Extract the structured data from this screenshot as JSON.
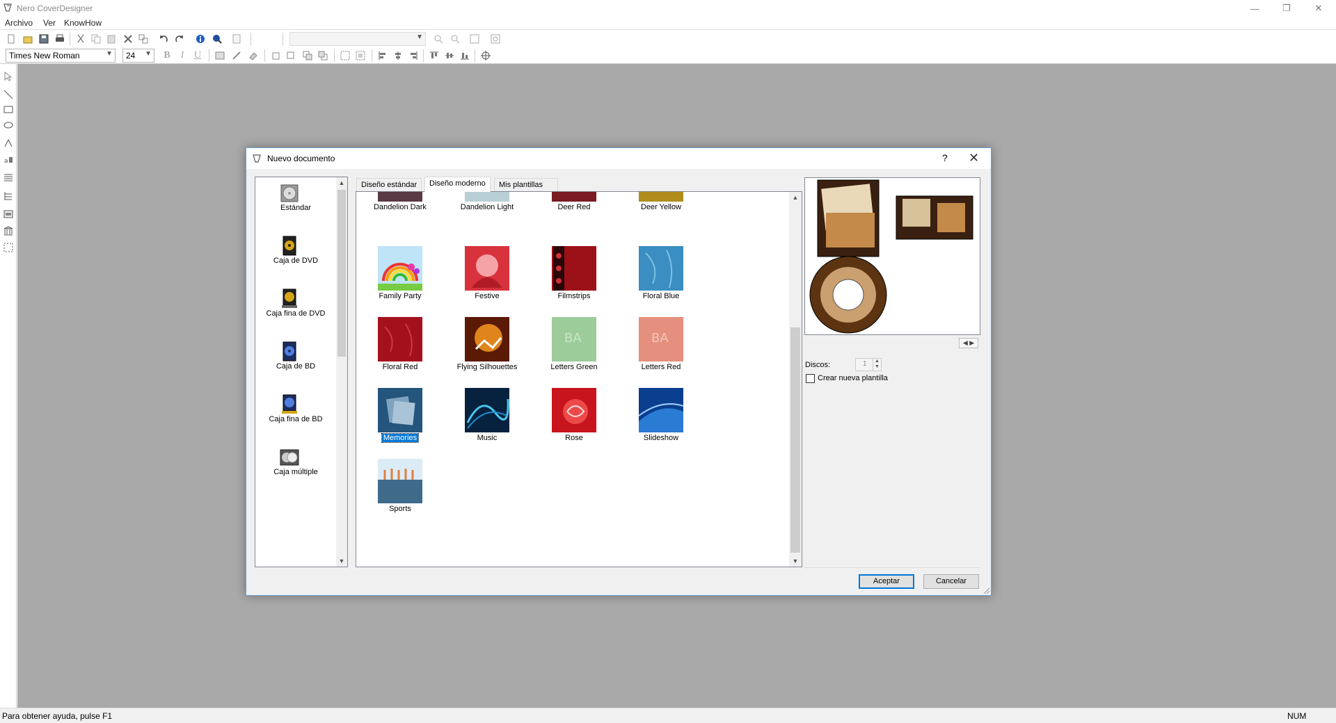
{
  "window": {
    "title": "Nero CoverDesigner"
  },
  "menu": [
    "Archivo",
    "Ver",
    "KnowHow"
  ],
  "toolbar": {
    "font_name": "Times New Roman",
    "font_size": "24"
  },
  "statusbar": {
    "help": "Para obtener ayuda, pulse F1",
    "num": "NUM"
  },
  "dialog": {
    "title": "Nuevo documento",
    "help": "?",
    "categories": [
      {
        "label": "Estándar"
      },
      {
        "label": "Caja de DVD"
      },
      {
        "label": "Caja fina de DVD"
      },
      {
        "label": "Caja de BD"
      },
      {
        "label": "Caja fina de BD"
      },
      {
        "label": "Caja múltiple"
      }
    ],
    "tabs": [
      {
        "label": "Diseño estándar"
      },
      {
        "label": "Diseño moderno"
      },
      {
        "label": "Mis plantillas"
      }
    ],
    "templates": [
      {
        "name": "Dandelion Dark"
      },
      {
        "name": "Dandelion Light"
      },
      {
        "name": "Deer Red"
      },
      {
        "name": "Deer Yellow"
      },
      {
        "name": "Family Party"
      },
      {
        "name": "Festive"
      },
      {
        "name": "Filmstrips"
      },
      {
        "name": "Floral Blue"
      },
      {
        "name": "Floral Red"
      },
      {
        "name": "Flying Silhouettes"
      },
      {
        "name": "Letters Green"
      },
      {
        "name": "Letters Red"
      },
      {
        "name": "Memories"
      },
      {
        "name": "Music"
      },
      {
        "name": "Rose"
      },
      {
        "name": "Slideshow"
      },
      {
        "name": "Sports"
      }
    ],
    "selected_template": "Memories",
    "discos_label": "Discos:",
    "discos_value": "1",
    "new_template_label": "Crear nueva plantilla",
    "ok_label": "Aceptar",
    "cancel_label": "Cancelar"
  },
  "colors": {
    "workspace": "#a9a9a9",
    "dialog_bg": "#f0f0f0",
    "selection": "#0078d7"
  }
}
